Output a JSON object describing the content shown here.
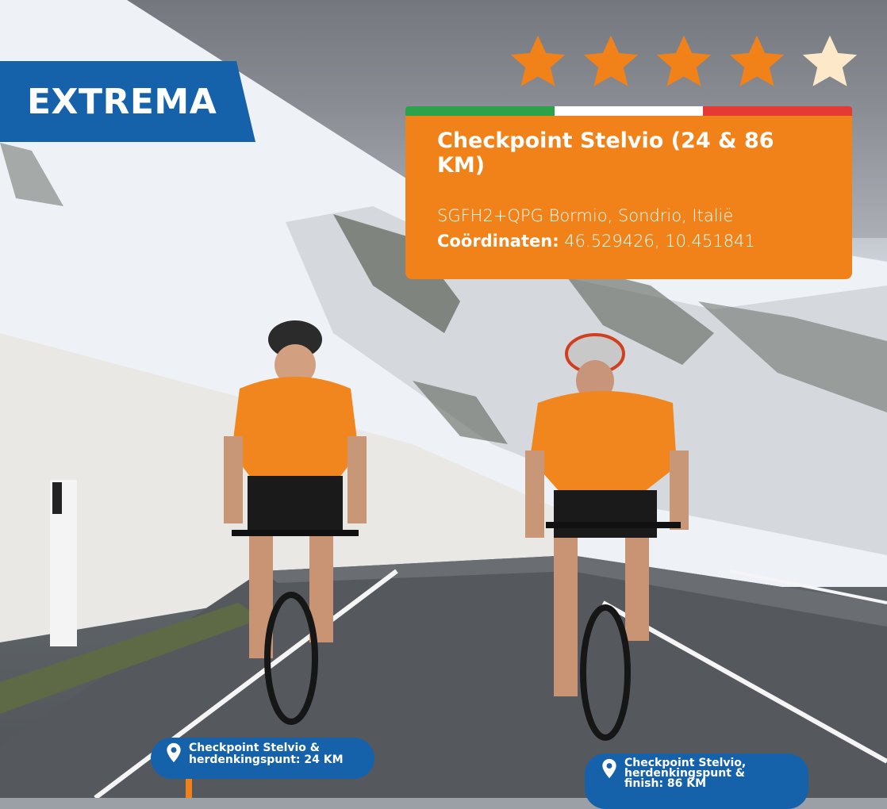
{
  "badge": {
    "label": "EXTREMA"
  },
  "rating": {
    "value": 4,
    "max": 5,
    "filled_color": "#f18219",
    "empty_color": "#fde9c9"
  },
  "flag_colors": [
    "#2ca24b",
    "#ffffff",
    "#e53935"
  ],
  "card": {
    "title": "Checkpoint Stelvio (24 & 86 KM)",
    "address": "SGFH2+QPG Bormio, Sondrio, Italië",
    "coordinates_label": "Coördinaten:",
    "coordinates_value": "46.529426, 10.451841"
  },
  "pins": [
    {
      "label": "Checkpoint Stelvio &\nherdenkingspunt: 24 KM",
      "icon": "location-pin-icon"
    },
    {
      "label": "Checkpoint Stelvio,\nherdenkingspunt &\nfinish: 86 KM",
      "icon": "location-pin-icon"
    }
  ],
  "colors": {
    "accent": "#f18219",
    "brand_blue": "#1562ab"
  }
}
